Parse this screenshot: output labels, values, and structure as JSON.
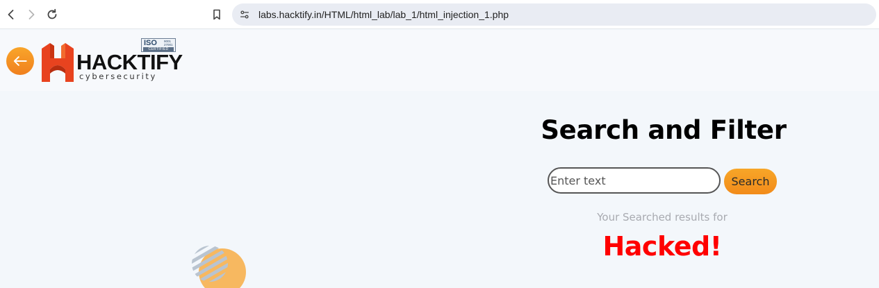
{
  "browser": {
    "url": "labs.hacktify.in/HTML/html_lab/lab_1/html_injection_1.php",
    "icons": {
      "back": "arrow-left-icon",
      "forward": "arrow-right-icon",
      "reload": "reload-icon",
      "bookmark": "bookmark-icon",
      "site_info": "tune-icon"
    }
  },
  "header": {
    "back_icon": "arrow-left-circle-icon",
    "logo": {
      "wordmark": "HACKTIFY",
      "subtitle": "cybersecurity",
      "iso_label": "ISO",
      "iso_number": "9001 27001",
      "iso_certified": "CERTIFIED"
    }
  },
  "main": {
    "title": "Search and Filter",
    "search": {
      "placeholder": "Enter text",
      "value": "",
      "button_label": "Search"
    },
    "results_label": "Your Searched results for",
    "results_term": "Hacked!"
  },
  "colors": {
    "accent_orange": "#f28b1a",
    "result_red": "#ff0000",
    "page_bg": "#f3f7fb"
  }
}
